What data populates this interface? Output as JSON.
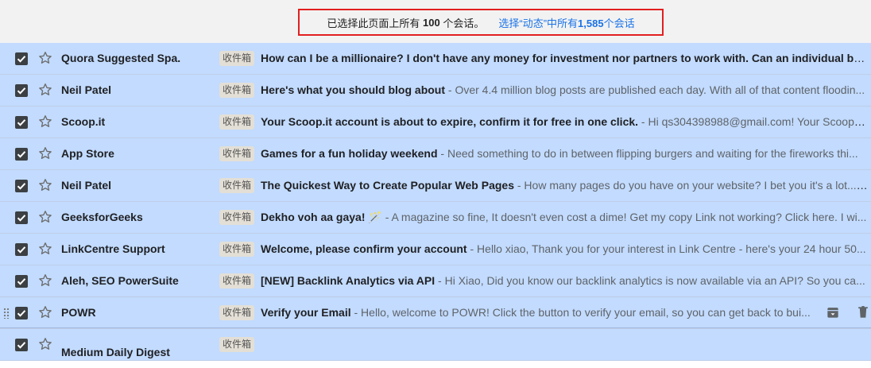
{
  "banner": {
    "selected_text": "已选择此页面上所有",
    "selected_count": "100",
    "selected_suffix": "个会话。",
    "select_all_prefix": "选择“动态”中所有",
    "select_all_count": "1,585",
    "select_all_suffix": "个会话"
  },
  "rows": [
    {
      "sender": "Quora Suggested Spa.",
      "label": "收件箱",
      "subject": "How can I be a millionaire? I don't have any money for investment nor partners to work with. Can an individual be sel...",
      "snippet": ""
    },
    {
      "sender": "Neil Patel",
      "label": "收件箱",
      "subject": "Here's what you should blog about",
      "snippet": " - Over 4.4 million blog posts are published each day. With all of that content floodin..."
    },
    {
      "sender": "Scoop.it",
      "label": "收件箱",
      "subject": "Your Scoop.it account is about to expire, confirm it for free in one click.",
      "snippet": " - Hi qs304398988@gmail.com! Your Scoop.it..."
    },
    {
      "sender": "App Store",
      "label": "收件箱",
      "subject": "Games for a fun holiday weekend",
      "snippet": " - Need something to do in between flipping burgers and waiting for the fireworks thi..."
    },
    {
      "sender": "Neil Patel",
      "label": "收件箱",
      "subject": "The Quickest Way to Create Popular Web Pages",
      "snippet": " - How many pages do you have on your website? I bet you it's a lot... ..."
    },
    {
      "sender": "GeeksforGeeks",
      "label": "收件箱",
      "subject": "Dekho voh aa gaya! 🪄",
      "snippet": " - A magazine so fine, It doesn't even cost a dime! Get my copy Link not working? Click here. I wi..."
    },
    {
      "sender": "LinkCentre Support",
      "label": "收件箱",
      "subject": "Welcome, please confirm your account",
      "snippet": " - Hello xiao, Thank you for your interest in Link Centre - here's your 24 hour 50..."
    },
    {
      "sender": "Aleh, SEO PowerSuite",
      "label": "收件箱",
      "subject": "[NEW] Backlink Analytics via API",
      "snippet": " - Hi Xiao, Did you know our backlink analytics is now available via an API? So you ca..."
    },
    {
      "sender": "POWR",
      "label": "收件箱",
      "subject": "Verify your Email",
      "snippet": " - Hello, welcome to POWR! Click the button to verify your email, so you can get back to bui..."
    },
    {
      "sender": "Medium Daily Digest",
      "label": "收件箱",
      "subject": "",
      "snippet": ""
    }
  ],
  "icons": {
    "checkbox": "checkbox-checked-icon",
    "star": "star-outline-icon",
    "archive": "archive-icon",
    "delete": "trash-icon",
    "drag": "drag-handle-icon"
  },
  "colors": {
    "selected_row": "#c2dbff",
    "link": "#1a73e8",
    "highlight_box": "#e21f1f"
  }
}
